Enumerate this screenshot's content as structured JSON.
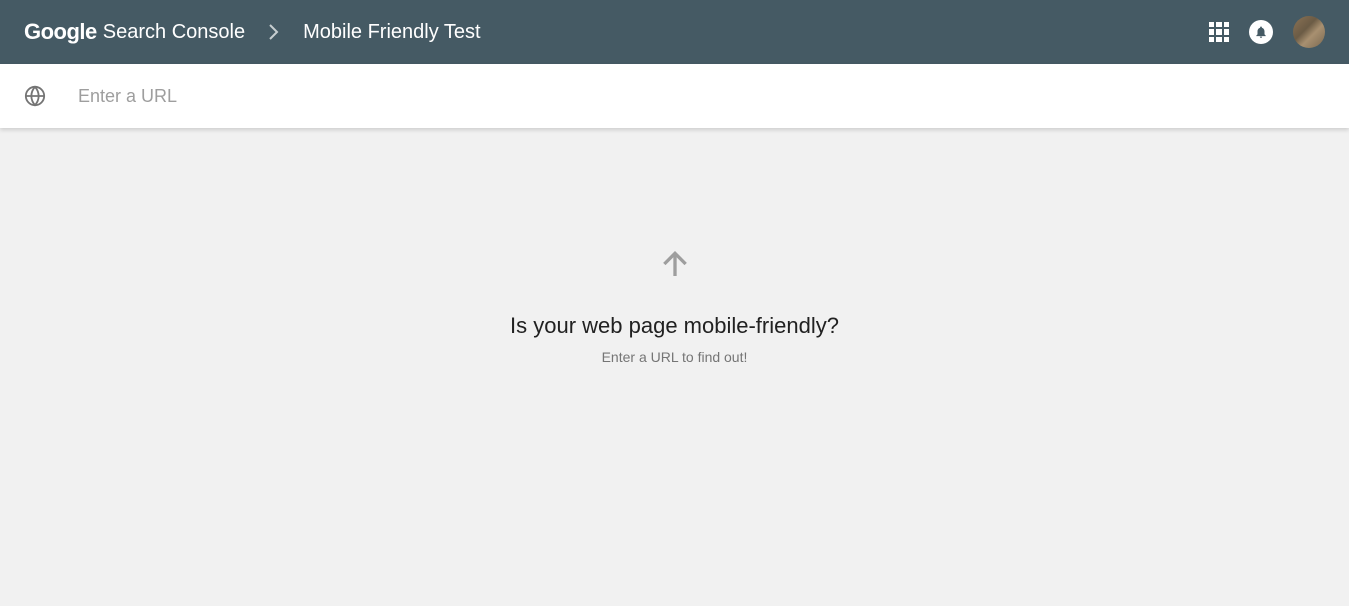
{
  "header": {
    "logo_brand": "Google",
    "logo_product": "Search Console",
    "page_title": "Mobile Friendly Test"
  },
  "search": {
    "placeholder": "Enter a URL"
  },
  "main": {
    "heading": "Is your web page mobile-friendly?",
    "subtext": "Enter a URL to find out!"
  }
}
